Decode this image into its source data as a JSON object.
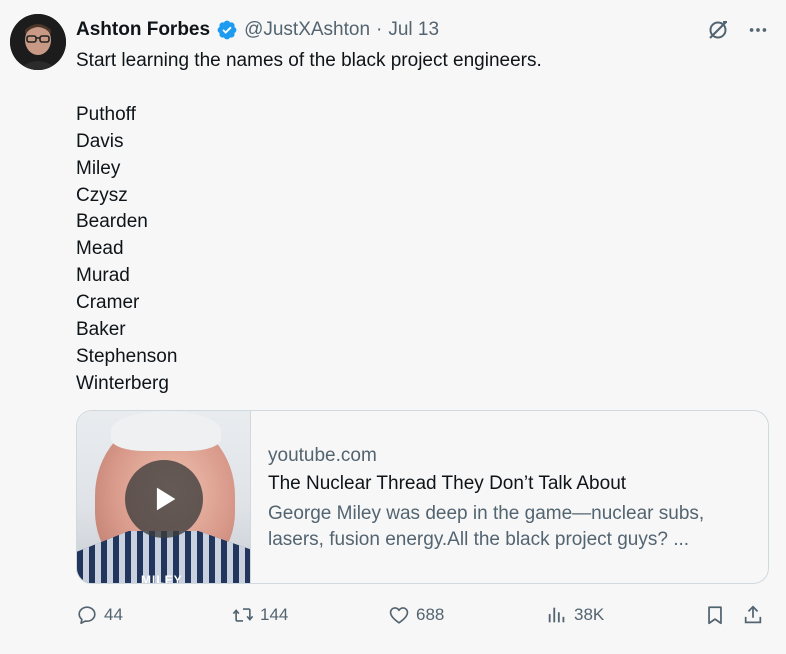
{
  "tweet": {
    "author": {
      "display_name": "Ashton Forbes",
      "handle": "@JustXAshton",
      "separator": "·",
      "date": "Jul 13"
    },
    "text": {
      "intro": "Start learning the names of the black project engineers.",
      "names": [
        "Puthoff",
        "Davis",
        "Miley",
        "Czysz",
        "Bearden",
        "Mead",
        "Murad",
        "Cramer",
        "Baker",
        "Stephenson",
        "Winterberg"
      ]
    },
    "card": {
      "domain": "youtube.com",
      "title": "The Nuclear Thread They Don’t Talk About",
      "description": "George Miley was deep in the game—nuclear subs, lasers, fusion energy.All the black project guys? ...",
      "thumbnail_caption": "MILEY"
    },
    "actions": {
      "replies": "44",
      "reposts": "144",
      "likes": "688",
      "views": "38K"
    }
  },
  "colors": {
    "background": "#f7f7f7",
    "text": "#0f1419",
    "muted": "#536471",
    "verified_badge": "#1d9bf0",
    "border": "#cfd9de"
  },
  "icons": {
    "verified": "verified-badge-icon",
    "grok": "grok-icon",
    "more": "more-icon",
    "reply": "reply-icon",
    "repost": "repost-icon",
    "like": "heart-icon",
    "views": "views-icon",
    "bookmark": "bookmark-icon",
    "share": "share-icon",
    "play": "play-icon"
  }
}
